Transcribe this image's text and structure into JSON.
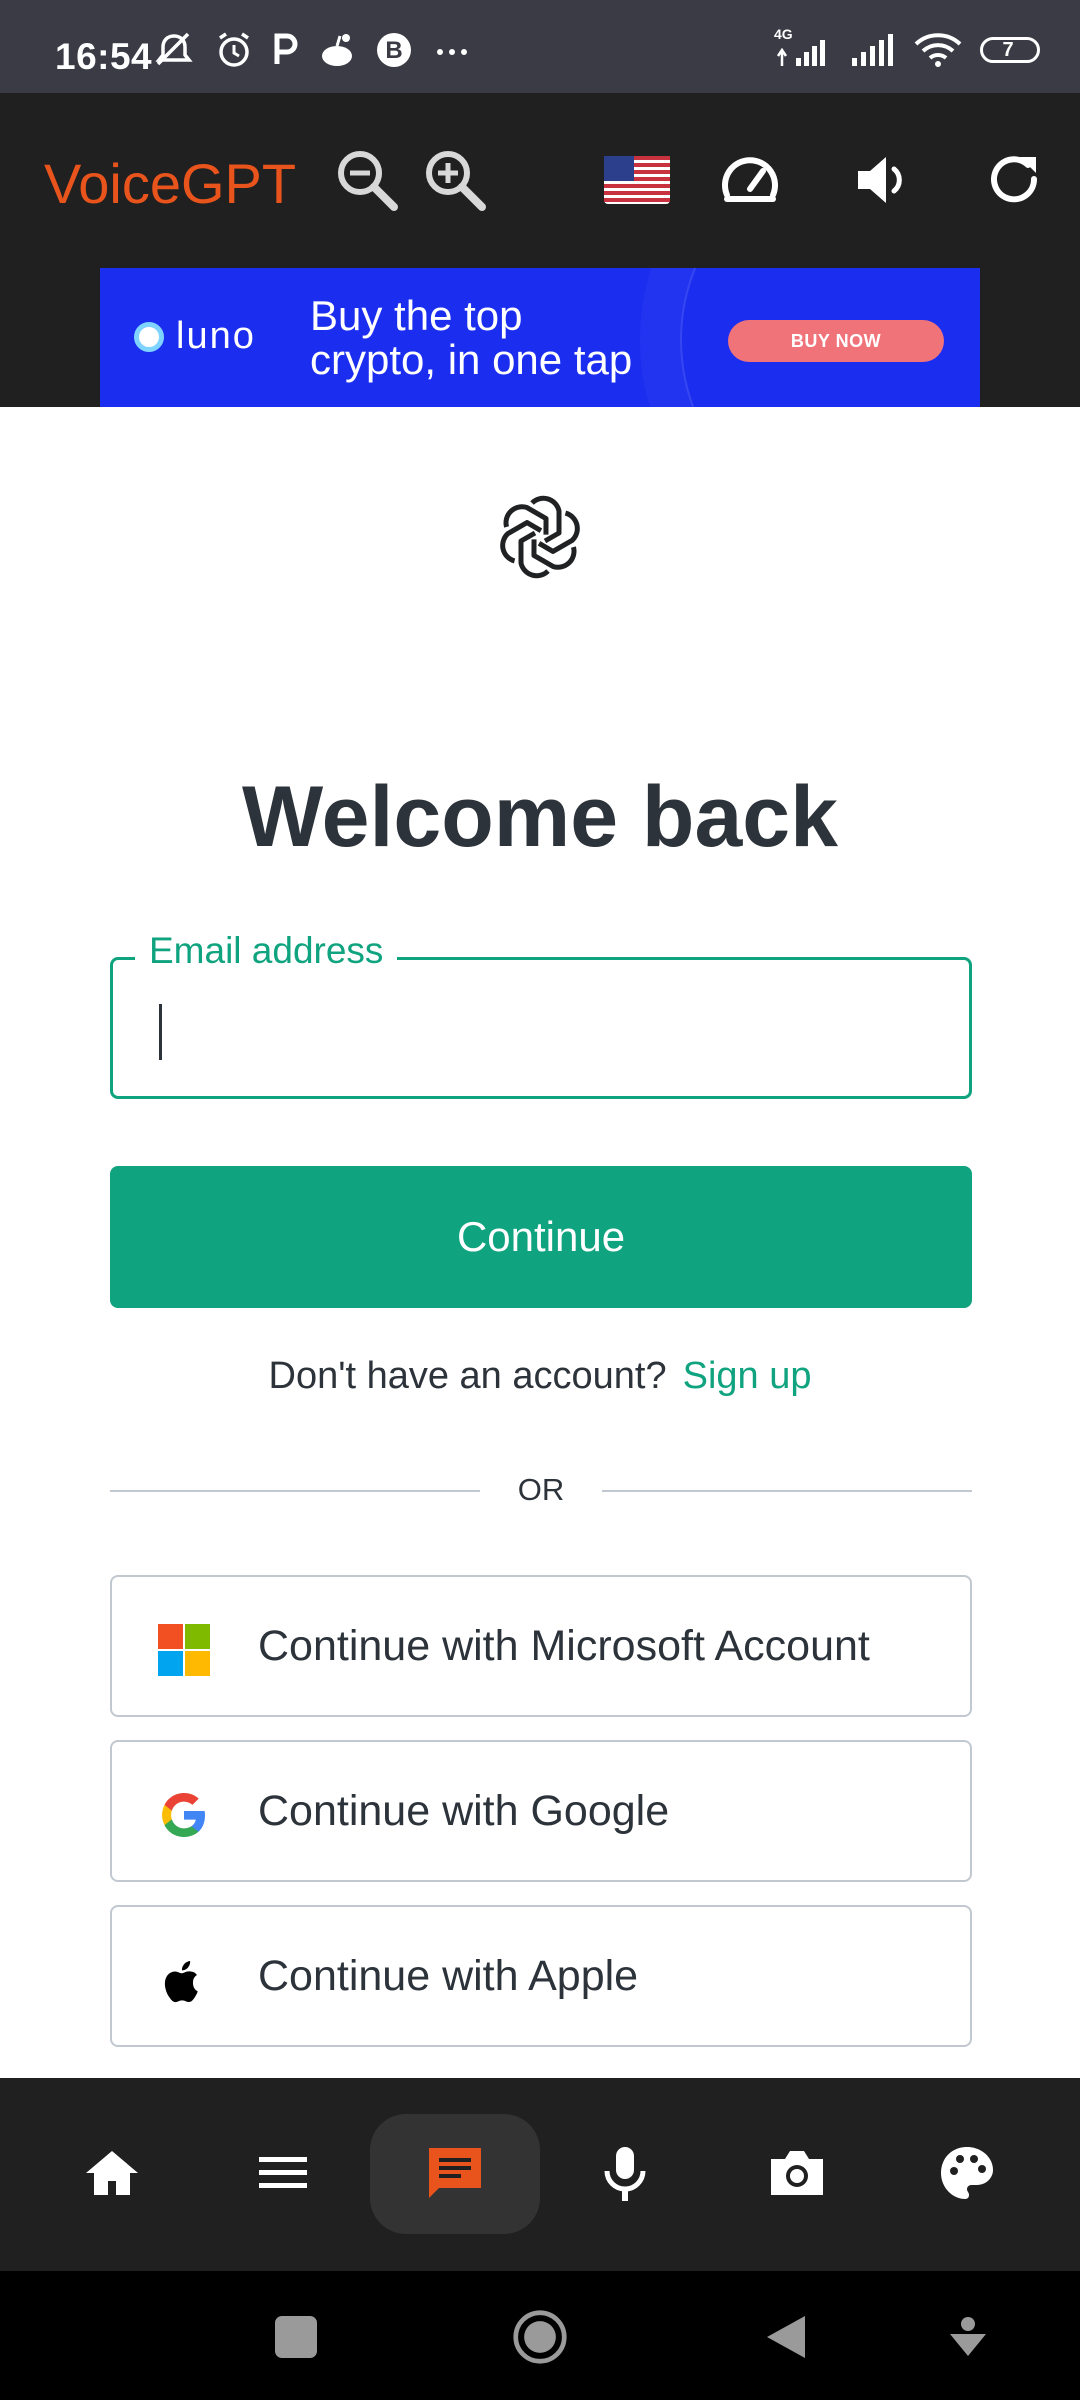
{
  "status_bar": {
    "time": "16:54",
    "network": "4G",
    "battery": "7"
  },
  "app_bar": {
    "brand": "VoiceGPT",
    "flag_icon": "us-flag-icon",
    "brand_color": "#e9541c"
  },
  "ad": {
    "brand": "LUNO",
    "line1": "Buy the top",
    "line2": "crypto, in one tap",
    "cta": "BUY NOW"
  },
  "login": {
    "title": "Welcome back",
    "email_label": "Email address",
    "email_value": "",
    "continue_label": "Continue",
    "no_account_text": "Don't have an account?",
    "signup_link": "Sign up",
    "or_text": "OR",
    "microsoft_label": "Continue with Microsoft Account",
    "google_label": "Continue with Google",
    "apple_label": "Continue with Apple",
    "accent_color": "#10a37f"
  },
  "bottom_nav": {
    "items": [
      "home-icon",
      "menu-icon",
      "chat-icon",
      "mic-icon",
      "camera-icon",
      "palette-icon"
    ],
    "active": "chat-icon",
    "active_color": "#e9541c"
  },
  "system_nav": {
    "items": [
      "recents-button",
      "home-button",
      "back-button",
      "dropdown-button"
    ]
  }
}
